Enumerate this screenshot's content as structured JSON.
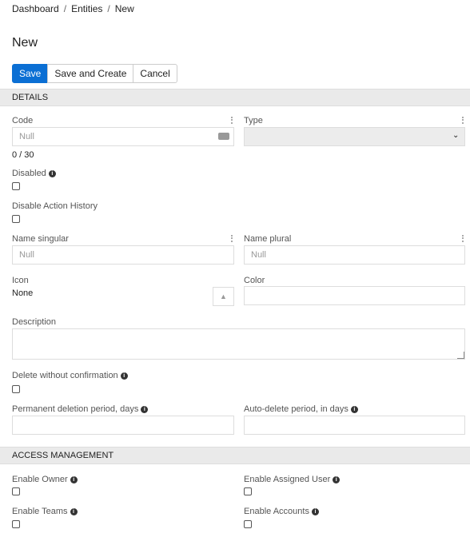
{
  "breadcrumb": {
    "items": [
      "Dashboard",
      "Entities",
      "New"
    ],
    "separator": "/"
  },
  "page": {
    "title": "New"
  },
  "toolbar": {
    "save": "Save",
    "save_create": "Save and Create",
    "cancel": "Cancel"
  },
  "sections": {
    "details": "DETAILS",
    "access": "ACCESS MANAGEMENT"
  },
  "fields": {
    "code": {
      "label": "Code",
      "placeholder": "Null",
      "counter": "0 / 30"
    },
    "type": {
      "label": "Type",
      "value": ""
    },
    "disabled": {
      "label": "Disabled"
    },
    "disable_action_history": {
      "label": "Disable Action History"
    },
    "name_singular": {
      "label": "Name singular",
      "placeholder": "Null"
    },
    "name_plural": {
      "label": "Name plural",
      "placeholder": "Null"
    },
    "icon": {
      "label": "Icon",
      "value": "None"
    },
    "color": {
      "label": "Color"
    },
    "description": {
      "label": "Description"
    },
    "delete_without_confirmation": {
      "label": "Delete without confirmation"
    },
    "permanent_deletion_period": {
      "label": "Permanent deletion period, days"
    },
    "auto_delete_period": {
      "label": "Auto-delete period, in days"
    },
    "enable_owner": {
      "label": "Enable Owner"
    },
    "enable_assigned_user": {
      "label": "Enable Assigned User"
    },
    "enable_teams": {
      "label": "Enable Teams"
    },
    "enable_accounts": {
      "label": "Enable Accounts"
    }
  },
  "colors": {
    "primary": "#0b6fd4",
    "section_bg": "#eaeaea"
  }
}
